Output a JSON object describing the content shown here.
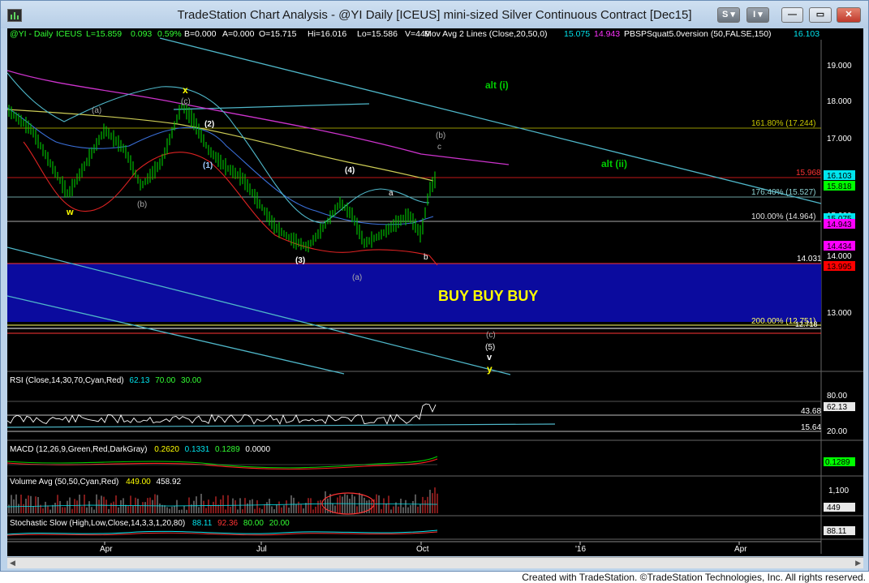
{
  "window": {
    "title": "TradeStation Chart Analysis - @YI Daily [ICEUS] mini-sized Silver Continuous Contract [Dec15]",
    "buttons": {
      "s_label": "S",
      "i_label": "I"
    }
  },
  "header": {
    "symbol": "@YI - Daily",
    "exchange": "ICEUS",
    "last": "L=15.859",
    "change": "0.093",
    "pct": "0.59%",
    "bid": "B=0.000",
    "ask": "A=0.000",
    "open": "O=15.715",
    "high": "Hi=16.016",
    "low": "Lo=15.586",
    "vol": "V=449",
    "ma_label": "Mov Avg 2 Lines (Close,20,50,0)",
    "ma1": "15.075",
    "ma2": "14.943",
    "study": "PBSPSquat5.0version (50,FALSE,150)",
    "study_val": "16.103"
  },
  "price_axis": {
    "ticks": [
      "19.000",
      "18.000",
      "17.000",
      "16.000",
      "15.000",
      "14.000",
      "13.000"
    ],
    "tags": [
      {
        "text": "16.103",
        "bg": "#00e5ee",
        "fg": "#000"
      },
      {
        "text": "15.818",
        "bg": "#00ff00",
        "fg": "#000"
      },
      {
        "text": "15.075",
        "bg": "#00e5ee",
        "fg": "#000"
      },
      {
        "text": "14.943",
        "bg": "#ff00ff",
        "fg": "#000"
      },
      {
        "text": "14.434",
        "bg": "#ff00ff",
        "fg": "#000"
      },
      {
        "text": "13.995",
        "bg": "#ff0000",
        "fg": "#000"
      }
    ]
  },
  "levels": {
    "fib_1618": "161.80% (17.244)",
    "red_line": "15.968",
    "fib_1764": "176.40% (15.527)",
    "fib_100": "100.00% (14.964)",
    "support": "14.031",
    "fib_200": "200.00% (12.751)",
    "fib_200b": "12.718"
  },
  "annotations": {
    "buy": "BUY BUY BUY",
    "alt_i": "alt (i)",
    "alt_ii": "alt (ii)",
    "x": "x",
    "w": "w",
    "a_paren": "(a)",
    "b_paren": "(b)",
    "c_paren": "(c)",
    "w2": "(2)",
    "w1": "(1)",
    "w3": "(3)",
    "w4": "(4)",
    "a_low": "(a)",
    "a": "a",
    "b": "b",
    "b_up": "(b)",
    "c": "c",
    "c_low": "(c)",
    "w5": "(5)",
    "v": "v",
    "y": "y"
  },
  "rsi": {
    "label": "RSI (Close,14,30,70,Cyan,Red)",
    "v1": "62.13",
    "v2": "70.00",
    "v3": "30.00",
    "ticks": [
      "80.00",
      "20.00"
    ],
    "tag": "62.13",
    "lvl1": "43.68",
    "lvl2": "15.64"
  },
  "macd": {
    "label": "MACD (12,26,9,Green,Red,DarkGray)",
    "v1": "0.2620",
    "v2": "0.1331",
    "v3": "0.1289",
    "v4": "0.0000",
    "tag": "0.1289"
  },
  "volume": {
    "label": "Volume Avg (50,50,Cyan,Red)",
    "v1": "449.00",
    "v2": "458.92",
    "tick": "1,100",
    "tag": "449"
  },
  "stoch": {
    "label": "Stochastic Slow (High,Low,Close,14,3,3,1,20,80)",
    "v1": "88.11",
    "v2": "92.36",
    "v3": "80.00",
    "v4": "20.00",
    "tag": "88.11"
  },
  "time_axis": [
    "Apr",
    "Jul",
    "Oct",
    "'16",
    "Apr"
  ],
  "footer": "Created with TradeStation. ©TradeStation Technologies, Inc. All rights reserved.",
  "colors": {
    "bg": "#000000",
    "bars": "#00cc00",
    "buy_zone": "#0a0a9c",
    "buy_text": "#ffff00",
    "wave_green": "#00cc00",
    "wave_yellow": "#ffff00",
    "trend": "#4fb7c9"
  }
}
